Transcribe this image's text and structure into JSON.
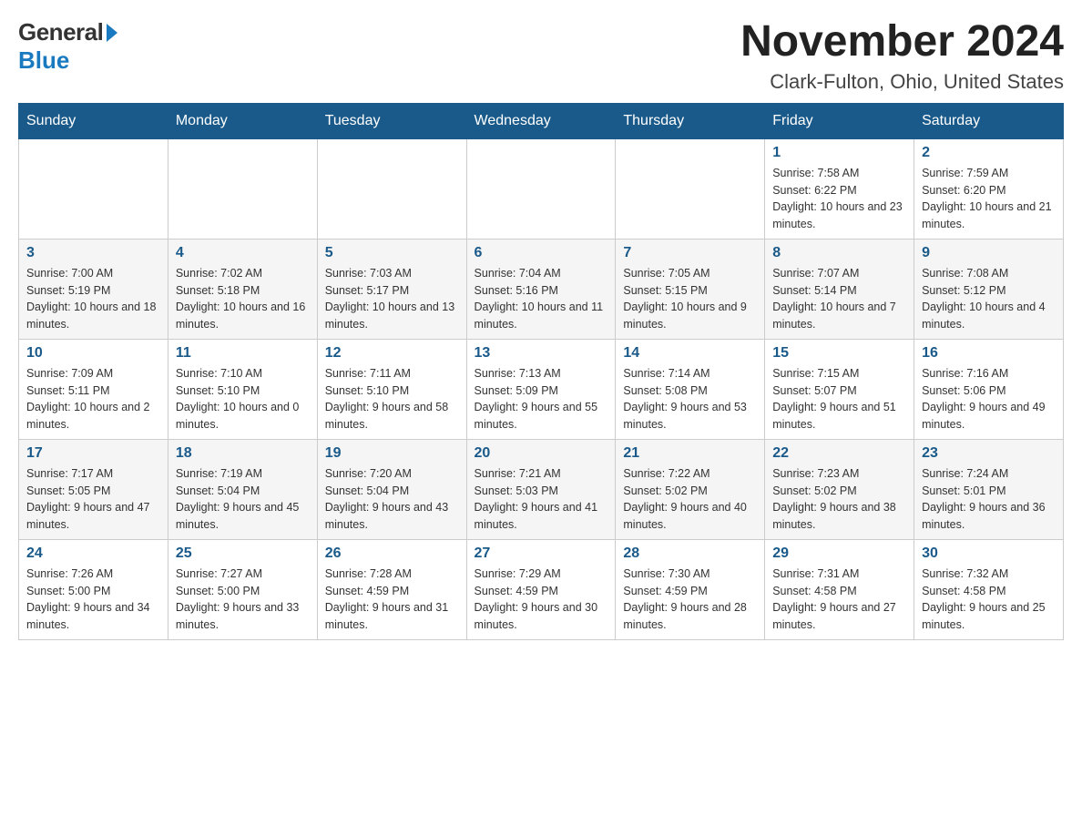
{
  "logo": {
    "general": "General",
    "blue": "Blue"
  },
  "title": "November 2024",
  "location": "Clark-Fulton, Ohio, United States",
  "days_of_week": [
    "Sunday",
    "Monday",
    "Tuesday",
    "Wednesday",
    "Thursday",
    "Friday",
    "Saturday"
  ],
  "weeks": [
    [
      null,
      null,
      null,
      null,
      null,
      {
        "day": "1",
        "sunrise": "Sunrise: 7:58 AM",
        "sunset": "Sunset: 6:22 PM",
        "daylight": "Daylight: 10 hours and 23 minutes."
      },
      {
        "day": "2",
        "sunrise": "Sunrise: 7:59 AM",
        "sunset": "Sunset: 6:20 PM",
        "daylight": "Daylight: 10 hours and 21 minutes."
      }
    ],
    [
      {
        "day": "3",
        "sunrise": "Sunrise: 7:00 AM",
        "sunset": "Sunset: 5:19 PM",
        "daylight": "Daylight: 10 hours and 18 minutes."
      },
      {
        "day": "4",
        "sunrise": "Sunrise: 7:02 AM",
        "sunset": "Sunset: 5:18 PM",
        "daylight": "Daylight: 10 hours and 16 minutes."
      },
      {
        "day": "5",
        "sunrise": "Sunrise: 7:03 AM",
        "sunset": "Sunset: 5:17 PM",
        "daylight": "Daylight: 10 hours and 13 minutes."
      },
      {
        "day": "6",
        "sunrise": "Sunrise: 7:04 AM",
        "sunset": "Sunset: 5:16 PM",
        "daylight": "Daylight: 10 hours and 11 minutes."
      },
      {
        "day": "7",
        "sunrise": "Sunrise: 7:05 AM",
        "sunset": "Sunset: 5:15 PM",
        "daylight": "Daylight: 10 hours and 9 minutes."
      },
      {
        "day": "8",
        "sunrise": "Sunrise: 7:07 AM",
        "sunset": "Sunset: 5:14 PM",
        "daylight": "Daylight: 10 hours and 7 minutes."
      },
      {
        "day": "9",
        "sunrise": "Sunrise: 7:08 AM",
        "sunset": "Sunset: 5:12 PM",
        "daylight": "Daylight: 10 hours and 4 minutes."
      }
    ],
    [
      {
        "day": "10",
        "sunrise": "Sunrise: 7:09 AM",
        "sunset": "Sunset: 5:11 PM",
        "daylight": "Daylight: 10 hours and 2 minutes."
      },
      {
        "day": "11",
        "sunrise": "Sunrise: 7:10 AM",
        "sunset": "Sunset: 5:10 PM",
        "daylight": "Daylight: 10 hours and 0 minutes."
      },
      {
        "day": "12",
        "sunrise": "Sunrise: 7:11 AM",
        "sunset": "Sunset: 5:10 PM",
        "daylight": "Daylight: 9 hours and 58 minutes."
      },
      {
        "day": "13",
        "sunrise": "Sunrise: 7:13 AM",
        "sunset": "Sunset: 5:09 PM",
        "daylight": "Daylight: 9 hours and 55 minutes."
      },
      {
        "day": "14",
        "sunrise": "Sunrise: 7:14 AM",
        "sunset": "Sunset: 5:08 PM",
        "daylight": "Daylight: 9 hours and 53 minutes."
      },
      {
        "day": "15",
        "sunrise": "Sunrise: 7:15 AM",
        "sunset": "Sunset: 5:07 PM",
        "daylight": "Daylight: 9 hours and 51 minutes."
      },
      {
        "day": "16",
        "sunrise": "Sunrise: 7:16 AM",
        "sunset": "Sunset: 5:06 PM",
        "daylight": "Daylight: 9 hours and 49 minutes."
      }
    ],
    [
      {
        "day": "17",
        "sunrise": "Sunrise: 7:17 AM",
        "sunset": "Sunset: 5:05 PM",
        "daylight": "Daylight: 9 hours and 47 minutes."
      },
      {
        "day": "18",
        "sunrise": "Sunrise: 7:19 AM",
        "sunset": "Sunset: 5:04 PM",
        "daylight": "Daylight: 9 hours and 45 minutes."
      },
      {
        "day": "19",
        "sunrise": "Sunrise: 7:20 AM",
        "sunset": "Sunset: 5:04 PM",
        "daylight": "Daylight: 9 hours and 43 minutes."
      },
      {
        "day": "20",
        "sunrise": "Sunrise: 7:21 AM",
        "sunset": "Sunset: 5:03 PM",
        "daylight": "Daylight: 9 hours and 41 minutes."
      },
      {
        "day": "21",
        "sunrise": "Sunrise: 7:22 AM",
        "sunset": "Sunset: 5:02 PM",
        "daylight": "Daylight: 9 hours and 40 minutes."
      },
      {
        "day": "22",
        "sunrise": "Sunrise: 7:23 AM",
        "sunset": "Sunset: 5:02 PM",
        "daylight": "Daylight: 9 hours and 38 minutes."
      },
      {
        "day": "23",
        "sunrise": "Sunrise: 7:24 AM",
        "sunset": "Sunset: 5:01 PM",
        "daylight": "Daylight: 9 hours and 36 minutes."
      }
    ],
    [
      {
        "day": "24",
        "sunrise": "Sunrise: 7:26 AM",
        "sunset": "Sunset: 5:00 PM",
        "daylight": "Daylight: 9 hours and 34 minutes."
      },
      {
        "day": "25",
        "sunrise": "Sunrise: 7:27 AM",
        "sunset": "Sunset: 5:00 PM",
        "daylight": "Daylight: 9 hours and 33 minutes."
      },
      {
        "day": "26",
        "sunrise": "Sunrise: 7:28 AM",
        "sunset": "Sunset: 4:59 PM",
        "daylight": "Daylight: 9 hours and 31 minutes."
      },
      {
        "day": "27",
        "sunrise": "Sunrise: 7:29 AM",
        "sunset": "Sunset: 4:59 PM",
        "daylight": "Daylight: 9 hours and 30 minutes."
      },
      {
        "day": "28",
        "sunrise": "Sunrise: 7:30 AM",
        "sunset": "Sunset: 4:59 PM",
        "daylight": "Daylight: 9 hours and 28 minutes."
      },
      {
        "day": "29",
        "sunrise": "Sunrise: 7:31 AM",
        "sunset": "Sunset: 4:58 PM",
        "daylight": "Daylight: 9 hours and 27 minutes."
      },
      {
        "day": "30",
        "sunrise": "Sunrise: 7:32 AM",
        "sunset": "Sunset: 4:58 PM",
        "daylight": "Daylight: 9 hours and 25 minutes."
      }
    ]
  ]
}
